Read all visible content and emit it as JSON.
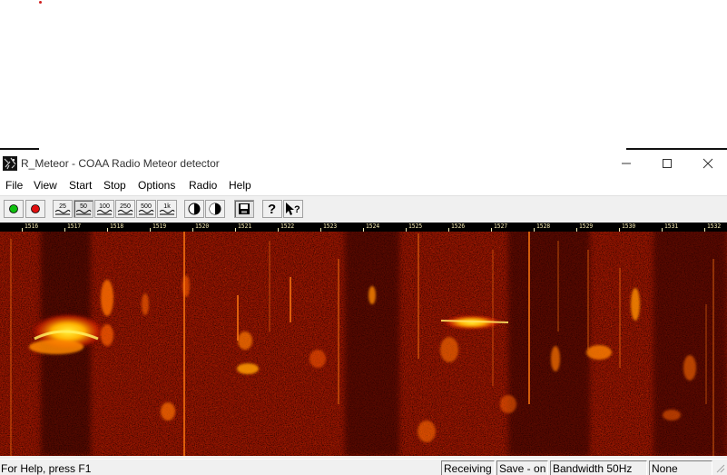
{
  "window": {
    "title": "R_Meteor - COAA Radio Meteor detector",
    "minimize_label": "",
    "maximize_label": "",
    "close_label": ""
  },
  "menu": [
    "File",
    "View",
    "Start",
    "Stop",
    "Options",
    "Radio",
    "Help"
  ],
  "toolbar": {
    "buttons": [
      {
        "name": "start-green-button",
        "icon": "green-dot-icon"
      },
      {
        "name": "stop-red-button",
        "icon": "red-dot-icon"
      },
      {
        "name": "bandwidth-25-button",
        "label": "25"
      },
      {
        "name": "bandwidth-50-button",
        "label": "50",
        "pressed": true
      },
      {
        "name": "bandwidth-100-button",
        "label": "100"
      },
      {
        "name": "bandwidth-250-button",
        "label": "250"
      },
      {
        "name": "bandwidth-500-button",
        "label": "500"
      },
      {
        "name": "bandwidth-1k-button",
        "label": "1k"
      },
      {
        "name": "contrast-button-1",
        "icon": "contrast-icon"
      },
      {
        "name": "contrast-button-2",
        "icon": "contrast-icon"
      },
      {
        "name": "save-button",
        "icon": "save-icon",
        "pressed": true
      },
      {
        "name": "help-button",
        "icon": "question-icon"
      },
      {
        "name": "context-help-button",
        "icon": "pointer-question-icon"
      }
    ]
  },
  "spectrogram": {
    "time_ticks": [
      "1516",
      "1517",
      "1518",
      "1519",
      "1520",
      "1521",
      "1522",
      "1523",
      "1524",
      "1525",
      "1526",
      "1527",
      "1528",
      "1529",
      "1530",
      "1531",
      "1532"
    ],
    "colors": {
      "background": "#4a0900",
      "hot": "#ffe020",
      "mid": "#d01800"
    }
  },
  "statusbar": {
    "help_text": "For Help, press F1",
    "panes": [
      "Receiving",
      "Save - on",
      "Bandwidth 50Hz",
      "None"
    ]
  }
}
